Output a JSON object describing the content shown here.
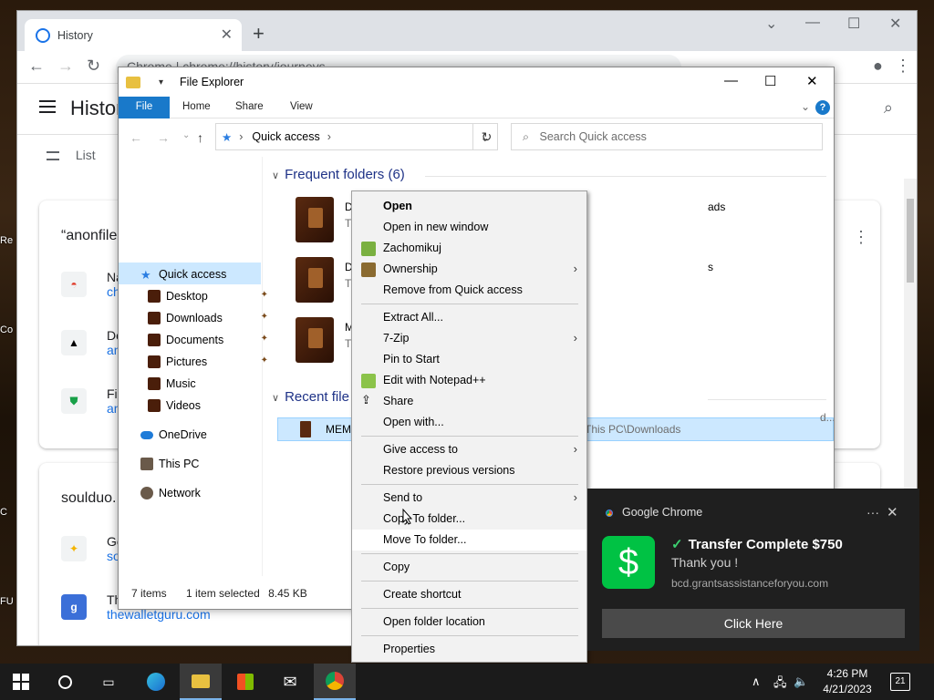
{
  "desktop": {
    "labels": [
      "Re",
      "Co",
      "C",
      "FU"
    ]
  },
  "chrome": {
    "tab_title": "History",
    "new_tab": "+",
    "address_scheme": "Chrome",
    "address_url": "chrome://history/journeys",
    "history_title": "History",
    "list_label": "List",
    "cards": [
      {
        "title": "“anonfile",
        "items": [
          {
            "text": "Na",
            "link": "ch"
          },
          {
            "text": "Do",
            "link": "an"
          },
          {
            "text": "Fil",
            "link": "an"
          }
        ]
      },
      {
        "title": "soulduo.",
        "items": [
          {
            "text": "Ge",
            "link": "so"
          },
          {
            "text": "Th",
            "link": "thewalletguru.com"
          }
        ]
      }
    ]
  },
  "explorer": {
    "title": "File Explorer",
    "ribbon": {
      "file": "File",
      "home": "Home",
      "share": "Share",
      "view": "View"
    },
    "path": "Quick access",
    "search_placeholder": "Search Quick access",
    "nav": {
      "quick_access": "Quick access",
      "desktop": "Desktop",
      "downloads": "Downloads",
      "documents": "Documents",
      "pictures": "Pictures",
      "music": "Music",
      "videos": "Videos",
      "onedrive": "OneDrive",
      "this_pc": "This PC",
      "network": "Network"
    },
    "frequent_header": "Frequent folders (6)",
    "recent_header": "Recent file",
    "folders_col1": [
      "D",
      "D",
      "M"
    ],
    "folders_col1_sub": [
      "T",
      "T",
      "T"
    ],
    "folders_col3": [
      "ads",
      "s"
    ],
    "recent_file": "MEM",
    "recent_location": "This PC\\Downloads",
    "recent_trailing": "d...",
    "status": {
      "items": "7 items",
      "selected": "1 item selected",
      "size": "8.45 KB"
    }
  },
  "context_menu": {
    "open": "Open",
    "open_new_window": "Open in new window",
    "zachomikuj": "Zachomikuj",
    "ownership": "Ownership",
    "remove_quick": "Remove from Quick access",
    "extract_all": "Extract All...",
    "seven_zip": "7-Zip",
    "pin_start": "Pin to Start",
    "edit_notepad": "Edit with Notepad++",
    "share": "Share",
    "open_with": "Open with...",
    "give_access": "Give access to",
    "restore_versions": "Restore previous versions",
    "send_to": "Send to",
    "copy_to": "Copy To folder...",
    "move_to": "Move To folder...",
    "copy": "Copy",
    "create_shortcut": "Create shortcut",
    "open_folder_location": "Open folder location",
    "properties": "Properties"
  },
  "notification": {
    "app": "Google Chrome",
    "title": "Transfer Complete $750",
    "message": "Thank you !",
    "url": "bcd.grantsassistanceforyou.com",
    "button": "Click Here"
  },
  "taskbar": {
    "time": "4:26 PM",
    "date": "4/21/2023",
    "notification_count": "21"
  },
  "colors": {
    "accent": "#1979ca",
    "selection": "#cce8ff",
    "notif_bg": "#1f1f1f",
    "cash_green": "#00c244"
  }
}
